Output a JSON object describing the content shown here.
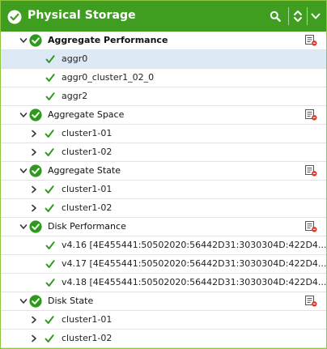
{
  "header": {
    "title": "Physical Storage",
    "icons": {
      "status": "check-circle-icon",
      "search": "search-icon",
      "sort": "sort-updown-icon",
      "collapse": "chevron-down-icon"
    }
  },
  "colors": {
    "header_bg": "#3f9e1f",
    "border": "#8cc63f",
    "selected_row": "#dde9f5",
    "check_green": "#2e9a1c"
  },
  "groups": [
    {
      "label": "Aggregate Performance",
      "expanded": true,
      "items": [
        {
          "label": "aggr0",
          "selected": true,
          "expandable": false
        },
        {
          "label": "aggr0_cluster1_02_0",
          "selected": false,
          "expandable": false
        },
        {
          "label": "aggr2",
          "selected": false,
          "expandable": false
        }
      ]
    },
    {
      "label": "Aggregate Space",
      "expanded": true,
      "items": [
        {
          "label": "cluster1-01",
          "expandable": true
        },
        {
          "label": "cluster1-02",
          "expandable": true
        }
      ]
    },
    {
      "label": "Aggregate State",
      "expanded": true,
      "items": [
        {
          "label": "cluster1-01",
          "expandable": true
        },
        {
          "label": "cluster1-02",
          "expandable": true
        }
      ]
    },
    {
      "label": "Disk Performance",
      "expanded": true,
      "items": [
        {
          "label": "v4.16 [4E455441:50502020:56442D31:3030304D:422D4...",
          "expandable": false
        },
        {
          "label": "v4.17 [4E455441:50502020:56442D31:3030304D:422D4...",
          "expandable": false
        },
        {
          "label": "v4.18 [4E455441:50502020:56442D31:3030304D:422D4...",
          "expandable": false
        }
      ]
    },
    {
      "label": "Disk State",
      "expanded": true,
      "items": [
        {
          "label": "cluster1-01",
          "expandable": true
        },
        {
          "label": "cluster1-02",
          "expandable": true
        }
      ]
    }
  ]
}
